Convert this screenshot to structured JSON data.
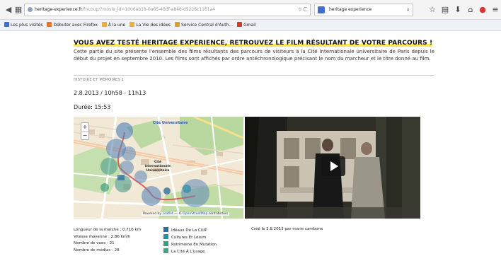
{
  "browser": {
    "url_domain": "heritage-experience.fr",
    "url_path": "/fr/coup/?movie_id=1006ab18-0a65-48df-a848-d5226c1161a4",
    "search_value": "heritage experience",
    "bookmarks": [
      {
        "label": "Les plus visités",
        "color": "#3d6fc4"
      },
      {
        "label": "Débuter avec Firefox",
        "color": "#e8742a"
      },
      {
        "label": "À la une",
        "color": "#e9b13a"
      },
      {
        "label": "La Vie des idées",
        "color": "#e9b13a"
      },
      {
        "label": "Service Central d'Auth...",
        "color": "#d9a32a"
      },
      {
        "label": "Gmail",
        "color": "#d3392c"
      }
    ]
  },
  "page": {
    "headline": "VOUS AVEZ TESTÉ HERITAGE EXPERIENCE, RETROUVEZ LE FILM RÉSULTANT DE VOTRE PARCOURS !",
    "intro": "Cette partie du site présente l'ensemble des films résultants des parcours de visiteurs à la Cité Internationale universitaire de Paris depuis le début du projet en septembre 2010. Les films sont affichés par ordre antéchronologique précisant le nom du marcheur et le titre donné au film.",
    "section_label": "HISTOIRE ET MÉMOIRES 1",
    "date_time": "2.8.2013 / 10h58 - 11h13",
    "duration": "Durée: 15:53"
  },
  "map": {
    "label_top": "Cité Universitaire",
    "label_center": "Cité Internationale Universitaire",
    "attribution_prefix": "Powered by",
    "attribution_leaflet": "Leaflet",
    "attribution_mid": "— ©",
    "attribution_osm": "OpenStreetMap",
    "attribution_suffix": "contributors",
    "zoom_in": "+",
    "zoom_out": "−"
  },
  "stats": {
    "length": "Longueur de la marche : 0.716 km",
    "speed": "Vitesse moyenne : 2.86 km/h",
    "views": "Nombre de vues : 21",
    "media": "Nombre de médias : 28"
  },
  "legend": [
    {
      "label": "Idéaux De La CiUP",
      "color": "#2f6d9e"
    },
    {
      "label": "Cultures Et Loisirs",
      "color": "#2b8fa3"
    },
    {
      "label": "Patrimoine En Mutation",
      "color": "#3e9c7c"
    },
    {
      "label": "La Cité À L'usage",
      "color": "#38a889"
    }
  ],
  "created": "Créé le 2.8.2013 par marie cambone",
  "colors": {
    "headline_highlight": "#ffe64a",
    "map_circle": "#5b86b8",
    "route": "#e0473f"
  }
}
